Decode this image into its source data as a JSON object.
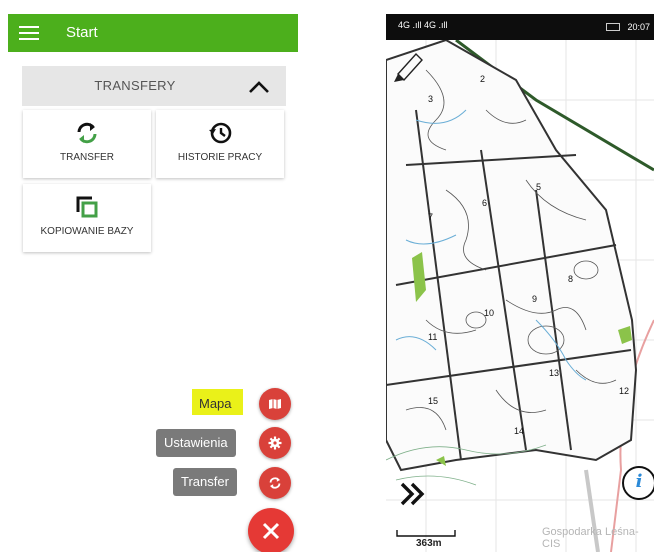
{
  "app": {
    "title": "Start",
    "section_title": "TRANSFERY"
  },
  "tiles": [
    {
      "label": "TRANSFER",
      "icon": "sync-icon"
    },
    {
      "label": "HISTORIE PRACY",
      "icon": "history-icon"
    },
    {
      "label": "KOPIOWANIE BAZY",
      "icon": "copy-icon"
    }
  ],
  "fab_menu": {
    "items": [
      {
        "label": "Mapa",
        "icon": "map-icon"
      },
      {
        "label": "Ustawienia",
        "icon": "gear-icon"
      },
      {
        "label": "Transfer",
        "icon": "sync-icon"
      }
    ],
    "close_icon": "close-icon"
  },
  "map_screen": {
    "status_time": "20:07",
    "signal_text": "4G .ıll 4G .ıll",
    "scale_label": "363m",
    "watermark": "Gospodarka Leśna-CIS",
    "section_numbers": [
      "2",
      "3",
      "5",
      "6",
      "7",
      "8",
      "9",
      "10",
      "11",
      "12",
      "13",
      "14",
      "15"
    ]
  },
  "colors": {
    "appbar": "#4caf1c",
    "tile_icon_green": "#43a047",
    "fab_red": "#d9413a",
    "label_grey": "#7a7a7a",
    "highlight": "#e8f000"
  }
}
